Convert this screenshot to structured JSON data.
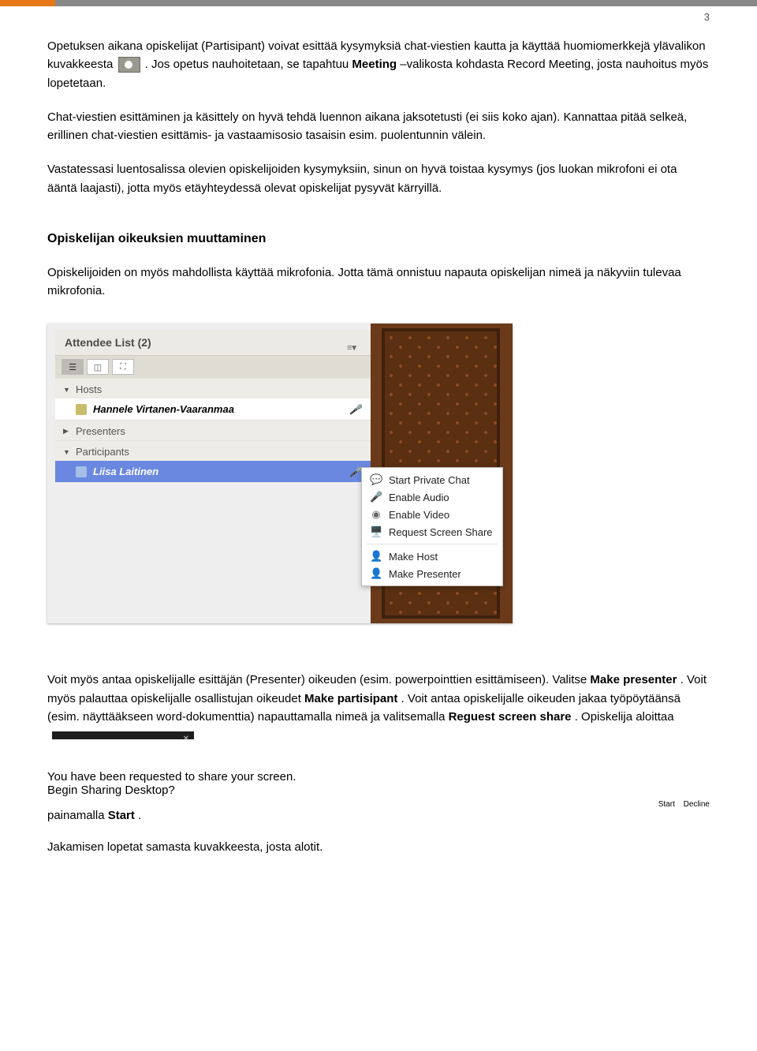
{
  "page_number": "3",
  "para1_a": "Opetuksen aikana opiskelijat (Partisipant) voivat esittää kysymyksiä chat-viestien kautta ja käyttää huomiomerkkejä ylävalikon kuvakkeesta ",
  "para1_b": ". Jos opetus nauhoitetaan, se tapahtuu ",
  "para1_bold1": "Meeting",
  "para1_c": " –valikosta kohdasta Record Meeting, josta nauhoitus myös lopetetaan.",
  "para2": "Chat-viestien esittäminen ja käsittely on hyvä tehdä luennon aikana jaksotetusti (ei siis koko ajan). Kannattaa pitää selkeä, erillinen chat-viestien esittämis- ja vastaamisosio tasaisin esim. puolentunnin välein.",
  "para3": "Vastatessasi luentosalissa olevien opiskelijoiden kysymyksiin, sinun on hyvä toistaa  kysymys (jos luokan mikrofoni ei ota ääntä laajasti), jotta myös etäyhteydessä olevat opiskelijat pysyvät kärryillä.",
  "heading1": "Opiskelijan oikeuksien muuttaminen",
  "para4": "Opiskelijoiden on myös mahdollista käyttää mikrofonia. Jotta tämä onnistuu napauta opiskelijan nimeä ja näkyviin tulevaa mikrofonia.",
  "screenshot": {
    "pod_title": "Attendee List  (2)",
    "hosts_label": "Hosts",
    "host_name": "Hannele Virtanen-Vaaranmaa",
    "presenters_label": "Presenters",
    "participants_label": "Participants",
    "participant_name": "Liisa Laitinen",
    "context_menu": [
      "Start Private Chat",
      "Enable Audio",
      "Enable Video",
      "Request Screen Share",
      "Make Host",
      "Make Presenter"
    ]
  },
  "para5_a": "Voit myös antaa opiskelijalle esittäjän (Presenter) oikeuden (esim. powerpointtien esittämiseen). Valitse ",
  "para5_bold1": "Make presenter",
  "para5_b": ". Voit myös palauttaa opiskelijalle osallistujan oikeudet ",
  "para5_bold2": "Make partisipant",
  "para5_c": ". Voit antaa opiskelijalle oikeuden jakaa työpöytäänsä (esim. näyttääkseen word-dokumenttia) napauttamalla nimeä ja valitsemalla ",
  "para5_bold3": "Reguest screen share",
  "para5_d": ". Opiskelija aloittaa",
  "para5_e": " painamalla ",
  "para5_bold4": "Start",
  "para5_f": ".",
  "share_popup": {
    "title": "Begin Sharing Desktop?",
    "line1": "You have been requested to share your screen.",
    "line2": "Begin Sharing Desktop?",
    "btn_start": "Start",
    "btn_decline": "Decline"
  },
  "para6": "Jakamisen lopetat samasta kuvakkeesta, josta alotit."
}
